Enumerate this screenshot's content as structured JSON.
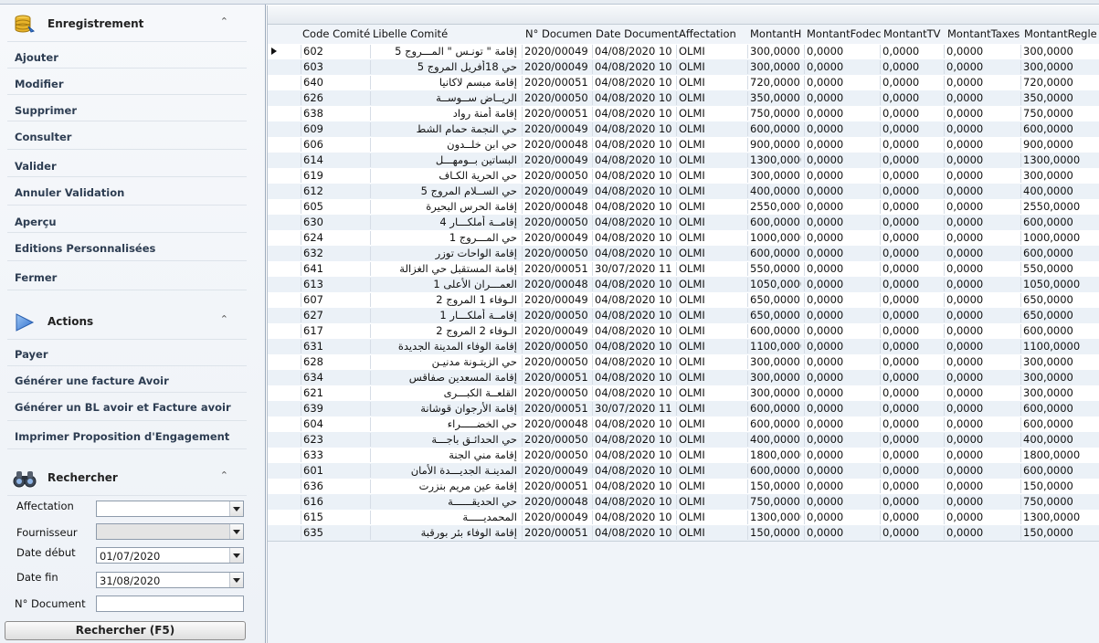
{
  "sidebar": {
    "enregistrement": {
      "title": "Enregistrement",
      "items": [
        "Ajouter",
        "Modifier",
        "Supprimer",
        "Consulter",
        "Valider",
        "Annuler Validation",
        "Aperçu",
        "Editions Personnalisées",
        "Fermer"
      ]
    },
    "actions": {
      "title": "Actions",
      "items": [
        "Payer",
        "Générer une facture Avoir",
        "Générer un BL avoir et Facture avoir",
        "Imprimer Proposition d'Engagement"
      ]
    },
    "rechercher": {
      "title": "Rechercher",
      "affectation_label": "Affectation",
      "affectation_value": "",
      "fournisseur_label": "Fournisseur",
      "fournisseur_value": "",
      "date_debut_label": "Date début",
      "date_debut_value": "01/07/2020",
      "date_fin_label": "Date fin",
      "date_fin_value": "31/08/2020",
      "ndoc_label": "N° Document",
      "ndoc_value": "",
      "button_label": "Rechercher (F5)"
    },
    "collapse_glyph": "⌃"
  },
  "grid": {
    "columns": [
      "Code Comité",
      "Libelle Comité",
      "N° Documen",
      "Date Document",
      "Affectation",
      "MontantH",
      "MontantFodec",
      "MontantTV",
      "MontantTaxes",
      "MontantRegle"
    ],
    "rows": [
      [
        "602",
        "إقامة \" تونـس \" المـــروج 5",
        "2020/00049",
        "04/08/2020 10",
        "OLMI",
        "300,0000",
        "0,0000",
        "0,0000",
        "0,0000",
        "300,0000"
      ],
      [
        "603",
        "حي 18أفريل المروج 5",
        "2020/00049",
        "04/08/2020 10",
        "OLMI",
        "300,0000",
        "0,0000",
        "0,0000",
        "0,0000",
        "300,0000"
      ],
      [
        "640",
        "إقامة مبسم لاكانيا",
        "2020/00051",
        "04/08/2020 10",
        "OLMI",
        "720,0000",
        "0,0000",
        "0,0000",
        "0,0000",
        "720,0000"
      ],
      [
        "626",
        "الريــاض ســوســة",
        "2020/00050",
        "04/08/2020 10",
        "OLMI",
        "350,0000",
        "0,0000",
        "0,0000",
        "0,0000",
        "350,0000"
      ],
      [
        "638",
        "إقامة أمنة رواد",
        "2020/00051",
        "04/08/2020 10",
        "OLMI",
        "750,0000",
        "0,0000",
        "0,0000",
        "0,0000",
        "750,0000"
      ],
      [
        "609",
        "حي النجمة حمام الشط",
        "2020/00049",
        "04/08/2020 10",
        "OLMI",
        "600,0000",
        "0,0000",
        "0,0000",
        "0,0000",
        "600,0000"
      ],
      [
        "606",
        "حي ابن خلــدون",
        "2020/00048",
        "04/08/2020 10",
        "OLMI",
        "900,0000",
        "0,0000",
        "0,0000",
        "0,0000",
        "900,0000"
      ],
      [
        "614",
        "البساتين بــومهـــل",
        "2020/00049",
        "04/08/2020 10",
        "OLMI",
        "1300,0000",
        "0,0000",
        "0,0000",
        "0,0000",
        "1300,0000"
      ],
      [
        "619",
        "حي الحرية الكـاف",
        "2020/00050",
        "04/08/2020 10",
        "OLMI",
        "300,0000",
        "0,0000",
        "0,0000",
        "0,0000",
        "300,0000"
      ],
      [
        "612",
        "حي الســلام المروج 5",
        "2020/00049",
        "04/08/2020 10",
        "OLMI",
        "400,0000",
        "0,0000",
        "0,0000",
        "0,0000",
        "400,0000"
      ],
      [
        "605",
        "إقامة الحرس البحيرة",
        "2020/00048",
        "04/08/2020 10",
        "OLMI",
        "2550,0000",
        "0,0000",
        "0,0000",
        "0,0000",
        "2550,0000"
      ],
      [
        "630",
        "إقامــة أملكـــار 4",
        "2020/00050",
        "04/08/2020 10",
        "OLMI",
        "600,0000",
        "0,0000",
        "0,0000",
        "0,0000",
        "600,0000"
      ],
      [
        "624",
        "حي المـــروج 1",
        "2020/00049",
        "04/08/2020 10",
        "OLMI",
        "1000,0000",
        "0,0000",
        "0,0000",
        "0,0000",
        "1000,0000"
      ],
      [
        "632",
        "إقامة الواحات توزر",
        "2020/00050",
        "04/08/2020 10",
        "OLMI",
        "600,0000",
        "0,0000",
        "0,0000",
        "0,0000",
        "600,0000"
      ],
      [
        "641",
        "إقامة المستقبل حي الغزالة",
        "2020/00051",
        "30/07/2020 11",
        "OLMI",
        "550,0000",
        "0,0000",
        "0,0000",
        "0,0000",
        "550,0000"
      ],
      [
        "613",
        "العمـــران الأعلى 1",
        "2020/00048",
        "04/08/2020 10",
        "OLMI",
        "1050,0000",
        "0,0000",
        "0,0000",
        "0,0000",
        "1050,0000"
      ],
      [
        "607",
        "الـوفاء 1 المروج 2",
        "2020/00049",
        "04/08/2020 10",
        "OLMI",
        "650,0000",
        "0,0000",
        "0,0000",
        "0,0000",
        "650,0000"
      ],
      [
        "627",
        "إقامــة أملكـــار 1",
        "2020/00050",
        "04/08/2020 10",
        "OLMI",
        "650,0000",
        "0,0000",
        "0,0000",
        "0,0000",
        "650,0000"
      ],
      [
        "617",
        "الـوفاء 2 المروج 2",
        "2020/00049",
        "04/08/2020 10",
        "OLMI",
        "600,0000",
        "0,0000",
        "0,0000",
        "0,0000",
        "600,0000"
      ],
      [
        "631",
        "إقامة الوفاء المدينة الجديدة",
        "2020/00050",
        "04/08/2020 10",
        "OLMI",
        "1100,0000",
        "0,0000",
        "0,0000",
        "0,0000",
        "1100,0000"
      ],
      [
        "628",
        "حي الزيتـونة مدنيـن",
        "2020/00050",
        "04/08/2020 10",
        "OLMI",
        "300,0000",
        "0,0000",
        "0,0000",
        "0,0000",
        "300,0000"
      ],
      [
        "634",
        "إقامة المسعدين صفاقس",
        "2020/00051",
        "04/08/2020 10",
        "OLMI",
        "300,0000",
        "0,0000",
        "0,0000",
        "0,0000",
        "300,0000"
      ],
      [
        "621",
        "القلعــة الكبـــرى",
        "2020/00050",
        "04/08/2020 10",
        "OLMI",
        "300,0000",
        "0,0000",
        "0,0000",
        "0,0000",
        "300,0000"
      ],
      [
        "639",
        "إقامة الأرجوان قوشانة",
        "2020/00051",
        "30/07/2020 11",
        "OLMI",
        "600,0000",
        "0,0000",
        "0,0000",
        "0,0000",
        "600,0000"
      ],
      [
        "604",
        "حي الخضـــــراء",
        "2020/00048",
        "04/08/2020 10",
        "OLMI",
        "600,0000",
        "0,0000",
        "0,0000",
        "0,0000",
        "600,0000"
      ],
      [
        "623",
        "حي الحدائـق باجـــة",
        "2020/00050",
        "04/08/2020 10",
        "OLMI",
        "400,0000",
        "0,0000",
        "0,0000",
        "0,0000",
        "400,0000"
      ],
      [
        "633",
        "إقامة مني الجنة",
        "2020/00050",
        "04/08/2020 10",
        "OLMI",
        "1800,0000",
        "0,0000",
        "0,0000",
        "0,0000",
        "1800,0000"
      ],
      [
        "601",
        "المدينـة الجديـــدة الأمان",
        "2020/00049",
        "04/08/2020 10",
        "OLMI",
        "600,0000",
        "0,0000",
        "0,0000",
        "0,0000",
        "600,0000"
      ],
      [
        "636",
        "إقامة عين مريم بنزرت",
        "2020/00051",
        "04/08/2020 10",
        "OLMI",
        "150,0000",
        "0,0000",
        "0,0000",
        "0,0000",
        "150,0000"
      ],
      [
        "616",
        "حي الحديقــــــة",
        "2020/00048",
        "04/08/2020 10",
        "OLMI",
        "750,0000",
        "0,0000",
        "0,0000",
        "0,0000",
        "750,0000"
      ],
      [
        "615",
        "المحمديـــــة",
        "2020/00049",
        "04/08/2020 10",
        "OLMI",
        "1300,0000",
        "0,0000",
        "0,0000",
        "0,0000",
        "1300,0000"
      ],
      [
        "635",
        "إقامة الوفاء بئر بورقبة",
        "2020/00051",
        "04/08/2020 10",
        "OLMI",
        "150,0000",
        "0,0000",
        "0,0000",
        "0,0000",
        "150,0000"
      ]
    ]
  },
  "icons": {
    "enregistrement": "database-icon",
    "actions": "play-arrow-icon",
    "rechercher": "binoculars-icon",
    "row_indicator": "row-pointer-icon",
    "dropdown": "chevron-down-icon"
  },
  "colors": {
    "accent": "#3b7dd8",
    "gold": "#d9a520",
    "row_alt": "#ebf1f7"
  }
}
